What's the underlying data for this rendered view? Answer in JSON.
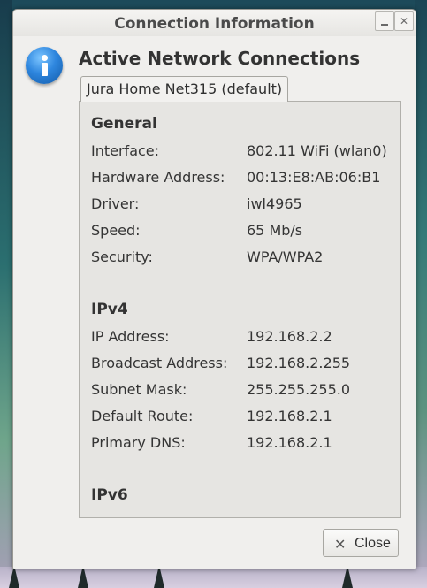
{
  "window": {
    "title": "Connection Information"
  },
  "header": {
    "icon": "info-icon",
    "heading": "Active Network Connections"
  },
  "tab": {
    "label": "Jura Home Net315 (default)"
  },
  "sections": [
    {
      "title": "General",
      "rows": [
        {
          "label": "Interface:",
          "value": "802.11 WiFi (wlan0)"
        },
        {
          "label": "Hardware Address:",
          "value": "00:13:E8:AB:06:B1"
        },
        {
          "label": "Driver:",
          "value": "iwl4965"
        },
        {
          "label": "Speed:",
          "value": "65 Mb/s"
        },
        {
          "label": "Security:",
          "value": "WPA/WPA2"
        }
      ]
    },
    {
      "title": "IPv4",
      "rows": [
        {
          "label": "IP Address:",
          "value": "192.168.2.2"
        },
        {
          "label": "Broadcast Address:",
          "value": "192.168.2.255"
        },
        {
          "label": "Subnet Mask:",
          "value": "255.255.255.0"
        },
        {
          "label": "Default Route:",
          "value": "192.168.2.1"
        },
        {
          "label": "Primary DNS:",
          "value": "192.168.2.1"
        }
      ]
    },
    {
      "title": "IPv6",
      "rows": []
    }
  ],
  "buttons": {
    "close": {
      "label": "Close",
      "icon": "close-icon"
    }
  }
}
